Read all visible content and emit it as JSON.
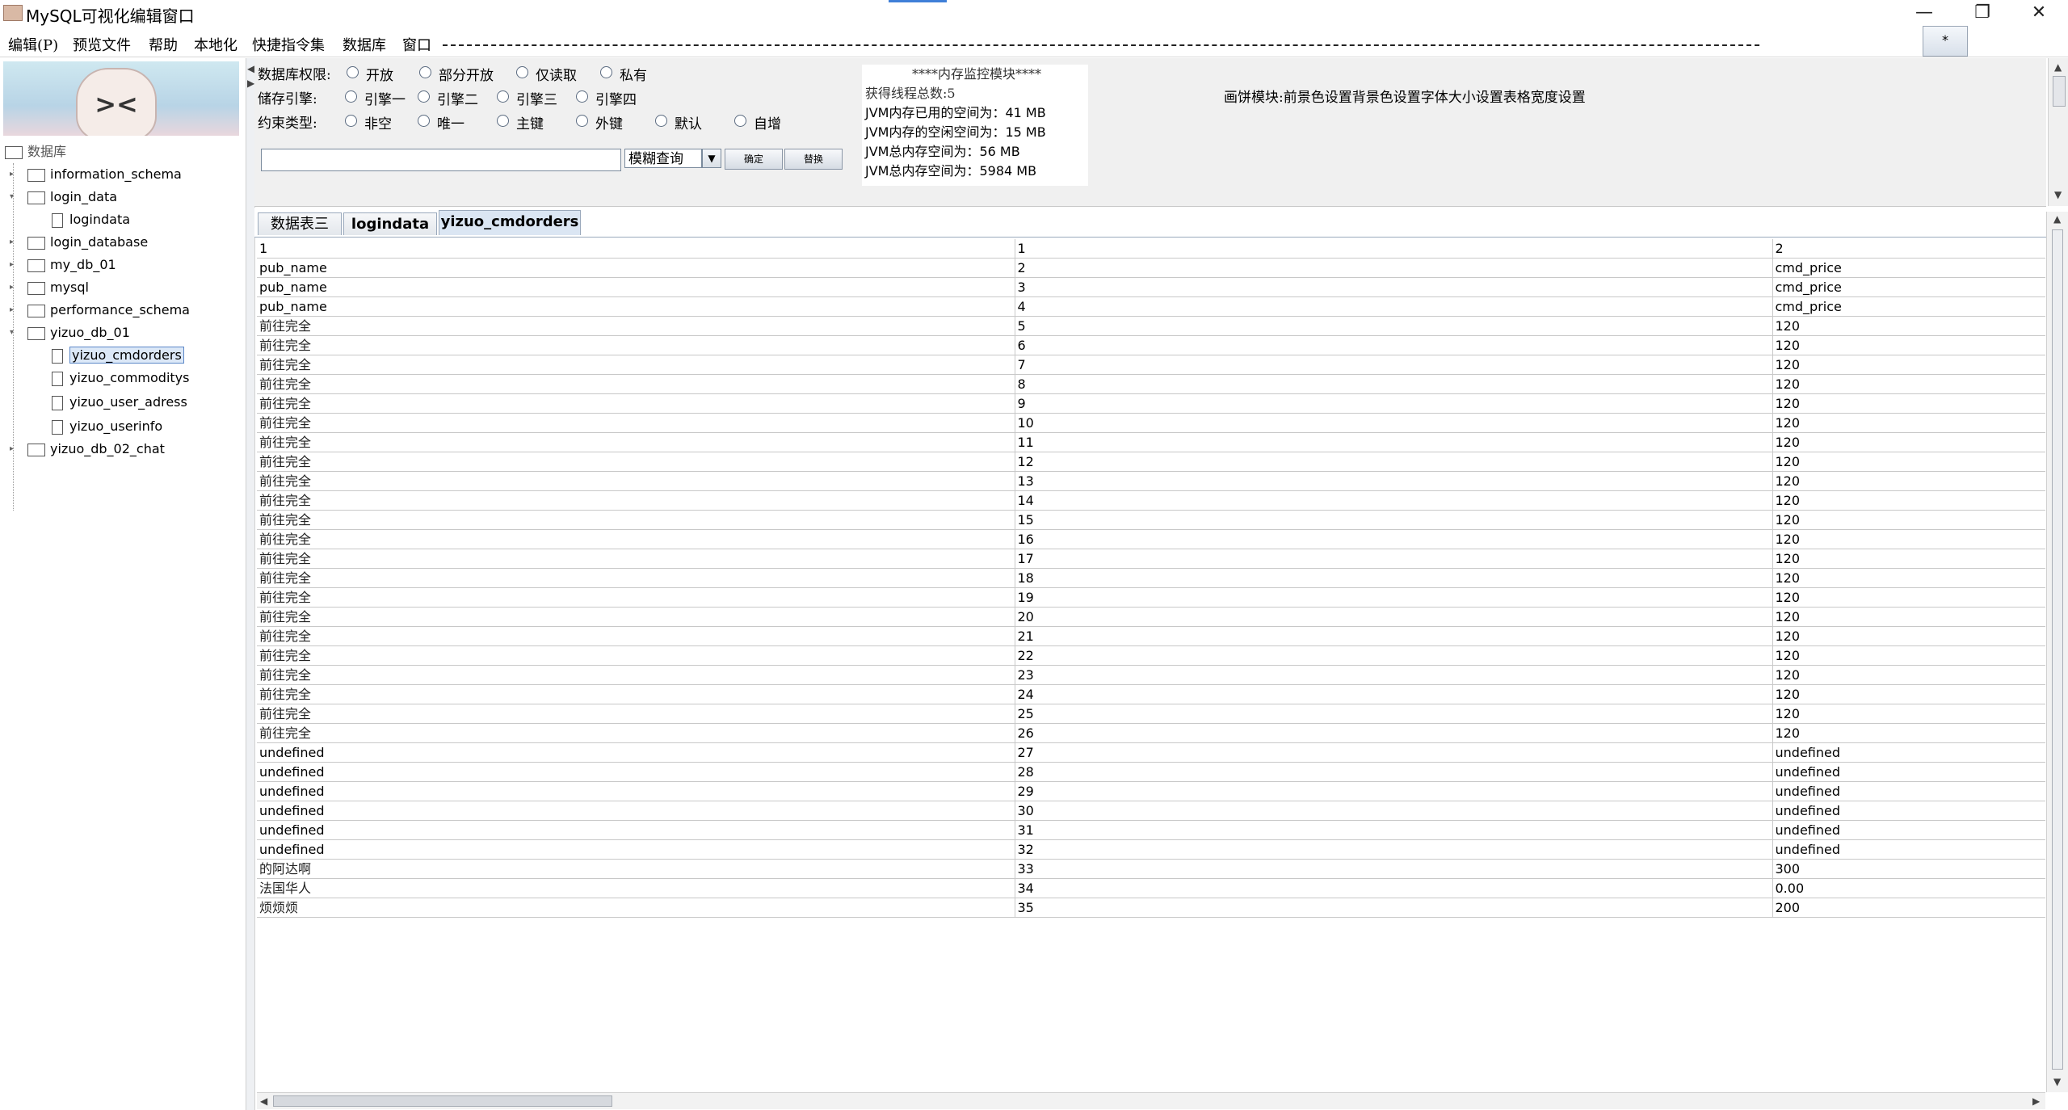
{
  "window": {
    "title": "MySQL可视化编辑窗口",
    "minimize_icon": "—",
    "restore_icon": "❐",
    "close_icon": "✕"
  },
  "menu": {
    "items": [
      "编辑(P)",
      "预览文件",
      "帮助",
      "本地化",
      "快捷指令集",
      "数据库",
      "窗口"
    ],
    "star_button": "*"
  },
  "tree": {
    "root": "数据库",
    "nodes": [
      {
        "label": "information_schema",
        "type": "folder",
        "level": 1
      },
      {
        "label": "login_data",
        "type": "folder",
        "level": 1
      },
      {
        "label": "logindata",
        "type": "file",
        "level": 2
      },
      {
        "label": "login_database",
        "type": "folder",
        "level": 1
      },
      {
        "label": "my_db_01",
        "type": "folder",
        "level": 1
      },
      {
        "label": "mysql",
        "type": "folder",
        "level": 1
      },
      {
        "label": "performance_schema",
        "type": "folder",
        "level": 1
      },
      {
        "label": "yizuo_db_01",
        "type": "folder",
        "level": 1
      },
      {
        "label": "yizuo_cmdorders",
        "type": "file",
        "level": 2,
        "selected": true
      },
      {
        "label": "yizuo_commoditys",
        "type": "file",
        "level": 2
      },
      {
        "label": "yizuo_user_adress",
        "type": "file",
        "level": 2
      },
      {
        "label": "yizuo_userinfo",
        "type": "file",
        "level": 2
      },
      {
        "label": "yizuo_db_02_chat",
        "type": "folder",
        "level": 1
      }
    ]
  },
  "controls": {
    "permission_label": "数据库权限:",
    "permission_options": [
      "开放",
      "部分开放",
      "仅读取",
      "私有"
    ],
    "engine_label": "储存引擎:",
    "engine_options": [
      "引擎一",
      "引擎二",
      "引擎三",
      "引擎四"
    ],
    "constraint_label": "约束类型:",
    "constraint_options": [
      "非空",
      "唯一",
      "主键",
      "外键",
      "默认",
      "自增"
    ],
    "search_value": "",
    "fuzzy_query": "模糊查询",
    "confirm_button": "确定",
    "replace_button": "替换"
  },
  "memory": {
    "title": "****内存监控模块****",
    "lines": [
      "获得线程总数:5",
      "JVM内存已用的空间为：41 MB",
      "JVM内存的空闲空间为：15 MB",
      "JVM总内存空间为：56 MB",
      "JVM总内存空间为：5984 MB"
    ]
  },
  "paint_module": "画饼模块:前景色设置背景色设置字体大小设置表格宽度设置",
  "tabs": [
    {
      "label": "数据表三",
      "active": false
    },
    {
      "label": "logindata",
      "active": false
    },
    {
      "label": "yizuo_cmdorders",
      "active": true
    }
  ],
  "table": {
    "rows": [
      [
        "1",
        "1",
        "2"
      ],
      [
        "pub_name",
        "2",
        "cmd_price"
      ],
      [
        "pub_name",
        "3",
        "cmd_price"
      ],
      [
        "pub_name",
        "4",
        "cmd_price"
      ],
      [
        "前往完全",
        "5",
        "120"
      ],
      [
        "前往完全",
        "6",
        "120"
      ],
      [
        "前往完全",
        "7",
        "120"
      ],
      [
        "前往完全",
        "8",
        "120"
      ],
      [
        "前往完全",
        "9",
        "120"
      ],
      [
        "前往完全",
        "10",
        "120"
      ],
      [
        "前往完全",
        "11",
        "120"
      ],
      [
        "前往完全",
        "12",
        "120"
      ],
      [
        "前往完全",
        "13",
        "120"
      ],
      [
        "前往完全",
        "14",
        "120"
      ],
      [
        "前往完全",
        "15",
        "120"
      ],
      [
        "前往完全",
        "16",
        "120"
      ],
      [
        "前往完全",
        "17",
        "120"
      ],
      [
        "前往完全",
        "18",
        "120"
      ],
      [
        "前往完全",
        "19",
        "120"
      ],
      [
        "前往完全",
        "20",
        "120"
      ],
      [
        "前往完全",
        "21",
        "120"
      ],
      [
        "前往完全",
        "22",
        "120"
      ],
      [
        "前往完全",
        "23",
        "120"
      ],
      [
        "前往完全",
        "24",
        "120"
      ],
      [
        "前往完全",
        "25",
        "120"
      ],
      [
        "前往完全",
        "26",
        "120"
      ],
      [
        "undefined",
        "27",
        "undefined"
      ],
      [
        "undefined",
        "28",
        "undefined"
      ],
      [
        "undefined",
        "29",
        "undefined"
      ],
      [
        "undefined",
        "30",
        "undefined"
      ],
      [
        "undefined",
        "31",
        "undefined"
      ],
      [
        "undefined",
        "32",
        "undefined"
      ],
      [
        "的阿达啊",
        "33",
        "300"
      ],
      [
        "法国华人",
        "34",
        "0.00"
      ],
      [
        "烦烦烦",
        "35",
        "200"
      ]
    ]
  },
  "colors": {
    "accent": "#3f7fd8",
    "panel_bg": "#f0f0f0",
    "grid": "#c8c8c8"
  }
}
